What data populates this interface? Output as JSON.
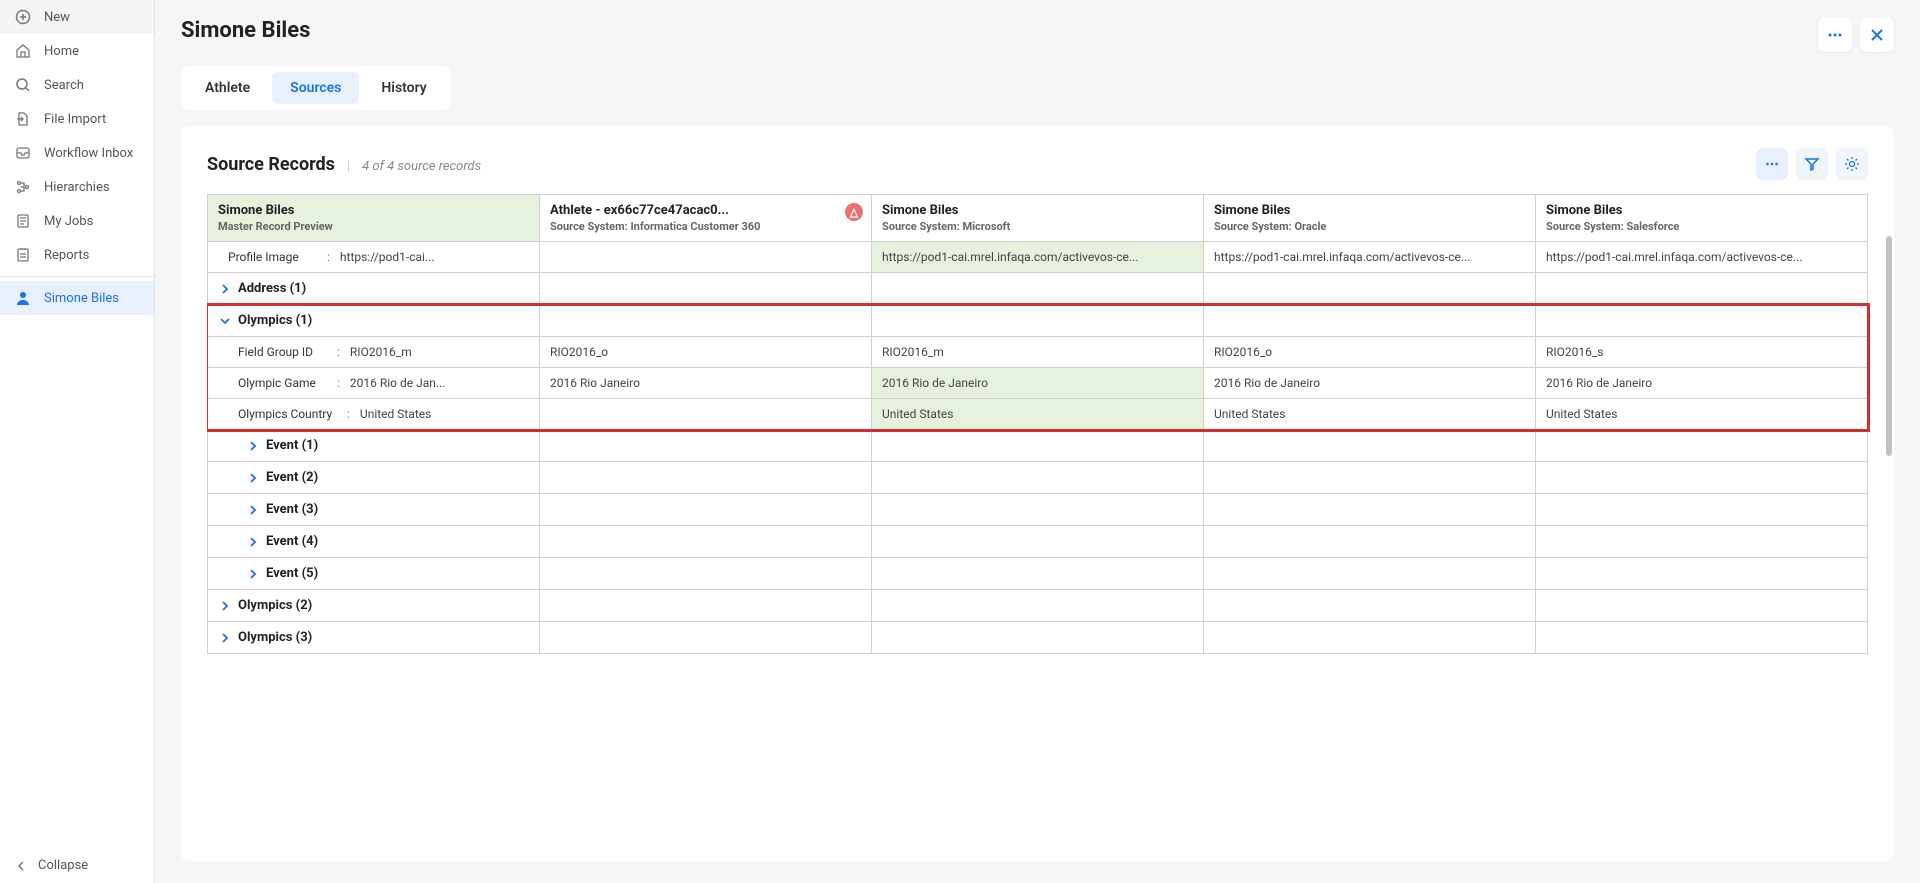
{
  "sidebar": {
    "items": [
      {
        "label": "New",
        "icon": "plus"
      },
      {
        "label": "Home",
        "icon": "home"
      },
      {
        "label": "Search",
        "icon": "search"
      },
      {
        "label": "File Import",
        "icon": "import"
      },
      {
        "label": "Workflow Inbox",
        "icon": "inbox"
      },
      {
        "label": "Hierarchies",
        "icon": "hierarchy"
      },
      {
        "label": "My Jobs",
        "icon": "jobs"
      },
      {
        "label": "Reports",
        "icon": "reports"
      }
    ],
    "active": {
      "label": "Simone Biles",
      "icon": "person"
    },
    "collapse": "Collapse"
  },
  "header": {
    "title": "Simone Biles"
  },
  "tabs": [
    {
      "label": "Athlete"
    },
    {
      "label": "Sources",
      "active": true
    },
    {
      "label": "History"
    }
  ],
  "card": {
    "title": "Source Records",
    "sub": "4 of 4 source records"
  },
  "columns": [
    {
      "name": "Simone Biles",
      "sub_label": "Master Record Preview",
      "master": true
    },
    {
      "name": "Athlete - ex66c77ce47acac0...",
      "sub_label": "Source System:",
      "sub_value": "Informatica Customer 360",
      "badge": true
    },
    {
      "name": "Simone Biles",
      "sub_label": "Source System:",
      "sub_value": "Microsoft"
    },
    {
      "name": "Simone Biles",
      "sub_label": "Source System:",
      "sub_value": "Oracle"
    },
    {
      "name": "Simone Biles",
      "sub_label": "Source System:",
      "sub_value": "Salesforce"
    }
  ],
  "rows": {
    "profile_image": {
      "field": "Profile Image",
      "master": "https://pod1-cai...",
      "c1": "",
      "c2": "https://pod1-cai.mrel.infaqa.com/activevos-ce...",
      "c2_hl": true,
      "c3": "https://pod1-cai.mrel.infaqa.com/activevos-ce...",
      "c4": "https://pod1-cai.mrel.infaqa.com/activevos-ce..."
    }
  },
  "groups": {
    "address": "Address (1)",
    "olympics1": "Olympics (1)",
    "event1": "Event (1)",
    "event2": "Event (2)",
    "event3": "Event (3)",
    "event4": "Event (4)",
    "event5": "Event (5)",
    "olympics2": "Olympics (2)",
    "olympics3": "Olympics (3)"
  },
  "olympics_fields": {
    "field_group_id": {
      "field": "Field Group ID",
      "master": "RIO2016_m",
      "c1": "RIO2016_o",
      "c2": "RIO2016_m",
      "c3": "RIO2016_o",
      "c4": "RIO2016_s"
    },
    "olympic_game": {
      "field": "Olympic Game",
      "master": "2016 Rio de Jan...",
      "c1": "2016 Rio Janeiro",
      "c2": "2016 Rio de Janeiro",
      "c2_hl": true,
      "c3": "2016 Rio de Janeiro",
      "c4": "2016 Rio de Janeiro"
    },
    "olympics_country": {
      "field": "Olympics Country",
      "master": "United States",
      "c1": "",
      "c2": "United States",
      "c2_hl": true,
      "c3": "United States",
      "c4": "United States"
    }
  }
}
